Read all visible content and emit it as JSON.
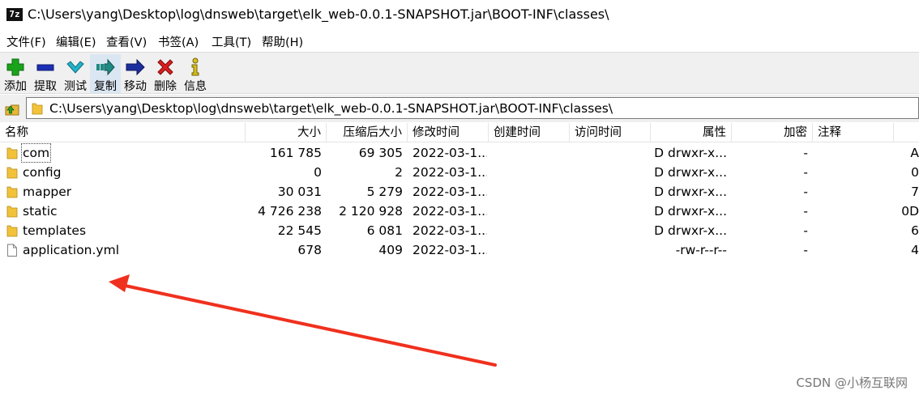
{
  "window": {
    "icon_text": "7z",
    "title": "C:\\Users\\yang\\Desktop\\log\\dnsweb\\target\\elk_web-0.0.1-SNAPSHOT.jar\\BOOT-INF\\classes\\"
  },
  "menu": [
    {
      "label": "文件(F)"
    },
    {
      "label": "编辑(E)"
    },
    {
      "label": "查看(V)"
    },
    {
      "label": "书签(A)"
    },
    {
      "label": "工具(T)"
    },
    {
      "label": "帮助(H)"
    }
  ],
  "toolbar": [
    {
      "label": "添加",
      "icon": "plus-icon",
      "color": "#1aa31a"
    },
    {
      "label": "提取",
      "icon": "minus-icon",
      "color": "#1b2fb5"
    },
    {
      "label": "测试",
      "icon": "check-icon",
      "color": "#22b2c9"
    },
    {
      "label": "复制",
      "icon": "copy-arrow-icon",
      "color": "#1f8a84"
    },
    {
      "label": "移动",
      "icon": "move-arrow-icon",
      "color": "#1c2e9e"
    },
    {
      "label": "删除",
      "icon": "delete-x-icon",
      "color": "#d81f1f"
    },
    {
      "label": "信息",
      "icon": "info-icon",
      "color": "#d8c21c"
    }
  ],
  "address": {
    "path": "C:\\Users\\yang\\Desktop\\log\\dnsweb\\target\\elk_web-0.0.1-SNAPSHOT.jar\\BOOT-INF\\classes\\"
  },
  "columns": [
    {
      "label": "名称"
    },
    {
      "label": "大小"
    },
    {
      "label": "压缩后大小"
    },
    {
      "label": "修改时间"
    },
    {
      "label": "创建时间"
    },
    {
      "label": "访问时间"
    },
    {
      "label": "属性"
    },
    {
      "label": "加密"
    },
    {
      "label": "注释"
    },
    {
      "label": ""
    }
  ],
  "rows": [
    {
      "type": "folder",
      "name": "com",
      "size": "161 785",
      "packed": "69 305",
      "modified": "2022-03-1...",
      "attr": "D drwxr-x...",
      "enc": "-",
      "extra": "A"
    },
    {
      "type": "folder",
      "name": "config",
      "size": "0",
      "packed": "2",
      "modified": "2022-03-1...",
      "attr": "D drwxr-x...",
      "enc": "-",
      "extra": "0"
    },
    {
      "type": "folder",
      "name": "mapper",
      "size": "30 031",
      "packed": "5 279",
      "modified": "2022-03-1...",
      "attr": "D drwxr-x...",
      "enc": "-",
      "extra": "7"
    },
    {
      "type": "folder",
      "name": "static",
      "size": "4 726 238",
      "packed": "2 120 928",
      "modified": "2022-03-1...",
      "attr": "D drwxr-x...",
      "enc": "-",
      "extra": "0D"
    },
    {
      "type": "folder",
      "name": "templates",
      "size": "22 545",
      "packed": "6 081",
      "modified": "2022-03-1...",
      "attr": "D drwxr-x...",
      "enc": "-",
      "extra": "6"
    },
    {
      "type": "file",
      "name": "application.yml",
      "size": "678",
      "packed": "409",
      "modified": "2022-03-1...",
      "attr": "-rw-r--r--",
      "enc": "-",
      "extra": "4"
    }
  ],
  "annotation": {
    "arrow_color": "#f0301e"
  },
  "watermark": "CSDN @小杨互联网"
}
